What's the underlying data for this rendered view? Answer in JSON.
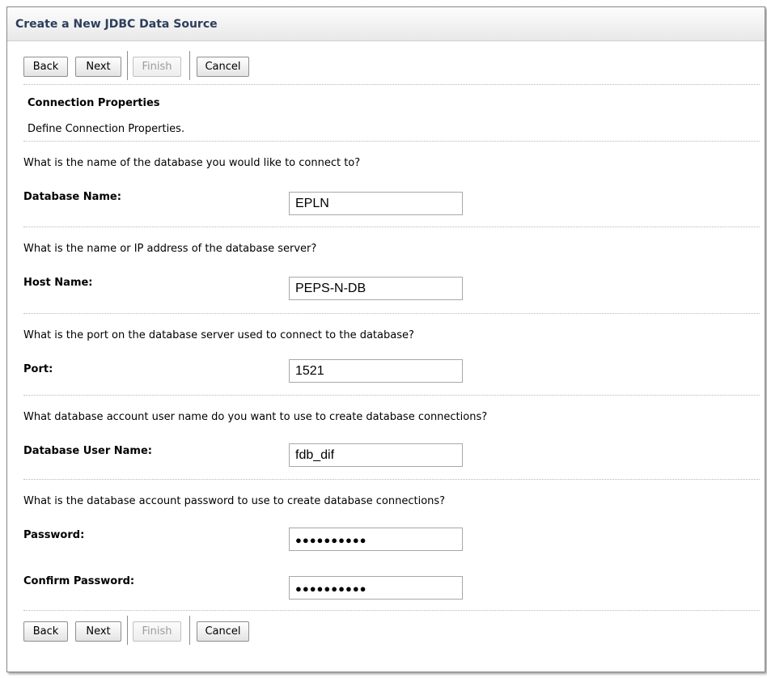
{
  "window": {
    "title": "Create a New JDBC Data Source"
  },
  "buttons": {
    "back": "Back",
    "next": "Next",
    "finish": "Finish",
    "cancel": "Cancel"
  },
  "section": {
    "heading": "Connection Properties",
    "description": "Define Connection Properties."
  },
  "fields": {
    "database_name": {
      "question": "What is the name of the database you would like to connect to?",
      "label": "Database Name:",
      "value": "EPLN"
    },
    "host_name": {
      "question": "What is the name or IP address of the database server?",
      "label": "Host Name:",
      "value": "PEPS-N-DB"
    },
    "port": {
      "question": "What is the port on the database server used to connect to the database?",
      "label": "Port:",
      "value": "1521"
    },
    "db_user": {
      "question": "What database account user name do you want to use to create database connections?",
      "label": "Database User Name:",
      "value": "fdb_dif"
    },
    "password": {
      "question": "What is the database account password to use to create database connections?",
      "label": "Password:",
      "value": "●●●●●●●●●●"
    },
    "confirm_password": {
      "label": "Confirm Password:",
      "value": "●●●●●●●●●●"
    }
  }
}
